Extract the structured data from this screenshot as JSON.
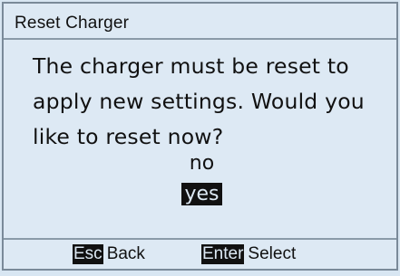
{
  "dialog": {
    "title": "Reset Charger",
    "message": "The charger must be reset to apply new settings. Would you like to reset now?"
  },
  "options": {
    "no": "no",
    "yes": "yes",
    "selected": "yes"
  },
  "footer": {
    "back_key": "Esc",
    "back_label": "Back",
    "select_key": "Enter",
    "select_label": "Select"
  }
}
